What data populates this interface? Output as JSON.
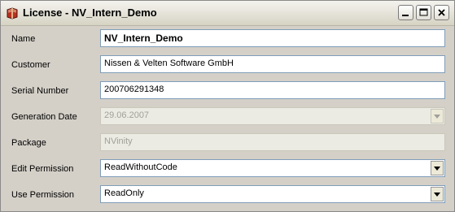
{
  "window": {
    "title": "License - NV_Intern_Demo"
  },
  "fields": [
    {
      "label": "Name",
      "value": "NV_Intern_Demo"
    },
    {
      "label": "Customer",
      "value": "Nissen & Velten Software GmbH"
    },
    {
      "label": "Serial Number",
      "value": "200706291348"
    },
    {
      "label": "Generation Date",
      "value": "29.06.2007"
    },
    {
      "label": "Package",
      "value": "NVinity"
    },
    {
      "label": "Edit Permission",
      "value": "ReadWithoutCode"
    },
    {
      "label": "Use Permission",
      "value": "ReadOnly"
    }
  ],
  "icons": {
    "app": "book-icon",
    "minimize": "minimize-icon",
    "maximize": "maximize-icon",
    "close": "close-icon",
    "dropdown": "chevron-down-icon"
  }
}
